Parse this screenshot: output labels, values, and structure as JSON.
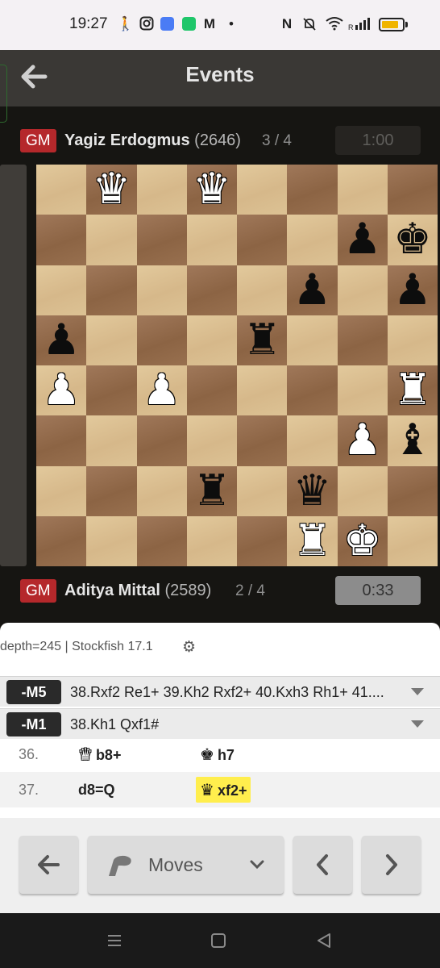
{
  "status_bar": {
    "time": "19:27",
    "icons": [
      "walk-icon",
      "instagram-icon",
      "chat-app-icon",
      "phone-app-icon",
      "gmail-icon",
      "dot-icon",
      "nfc-icon",
      "mute-icon",
      "wifi-icon",
      "signal-icon",
      "battery-icon"
    ],
    "battery_level": 0.85,
    "battery_color": "#f0b400"
  },
  "header": {
    "title": "Events",
    "back_icon": "arrow-left-icon"
  },
  "players": {
    "top": {
      "title": "GM",
      "name": "Yagiz Erdogmus",
      "rating": "(2646)",
      "score": "3 / 4",
      "clock": "1:00"
    },
    "bottom": {
      "title": "GM",
      "name": "Aditya Mittal",
      "rating": "(2589)",
      "score": "2 / 4",
      "clock": "0:33"
    }
  },
  "board": {
    "orientation": "white",
    "pieces": [
      {
        "sq": "b8",
        "p": "Q"
      },
      {
        "sq": "d8",
        "p": "Q"
      },
      {
        "sq": "g7",
        "p": "p"
      },
      {
        "sq": "h7",
        "p": "k"
      },
      {
        "sq": "f6",
        "p": "p"
      },
      {
        "sq": "h6",
        "p": "p"
      },
      {
        "sq": "a5",
        "p": "p"
      },
      {
        "sq": "e5",
        "p": "r"
      },
      {
        "sq": "a4",
        "p": "P"
      },
      {
        "sq": "c4",
        "p": "P"
      },
      {
        "sq": "h4",
        "p": "R"
      },
      {
        "sq": "g3",
        "p": "P"
      },
      {
        "sq": "h3",
        "p": "b"
      },
      {
        "sq": "d2",
        "p": "r"
      },
      {
        "sq": "f2",
        "p": "q"
      },
      {
        "sq": "f1",
        "p": "R"
      },
      {
        "sq": "g1",
        "p": "K"
      }
    ]
  },
  "analysis": {
    "engine": "depth=245 | Stockfish 17.1",
    "lines": [
      {
        "eval": "-M5",
        "moves": "38.Rxf2 Re1+ 39.Kh2 Rxf2+ 40.Kxh3 Rh1+ 41...."
      },
      {
        "eval": "-M1",
        "moves": "38.Kh1 Qxf1#"
      }
    ],
    "moves": [
      {
        "num": "36.",
        "white_piece": "Q",
        "white": "b8+",
        "black_piece": "k",
        "black": "h7"
      },
      {
        "num": "37.",
        "white_piece": "",
        "white": "d8=Q",
        "black_piece": "q",
        "black": "xf2+",
        "highlight": true
      }
    ]
  },
  "toolbar": {
    "moves_label": "Moves"
  },
  "colors": {
    "accent_badge": "#b5282b",
    "highlight": "#ffee4d",
    "board_light": "#d6b88a",
    "board_dark": "#8c6444"
  }
}
